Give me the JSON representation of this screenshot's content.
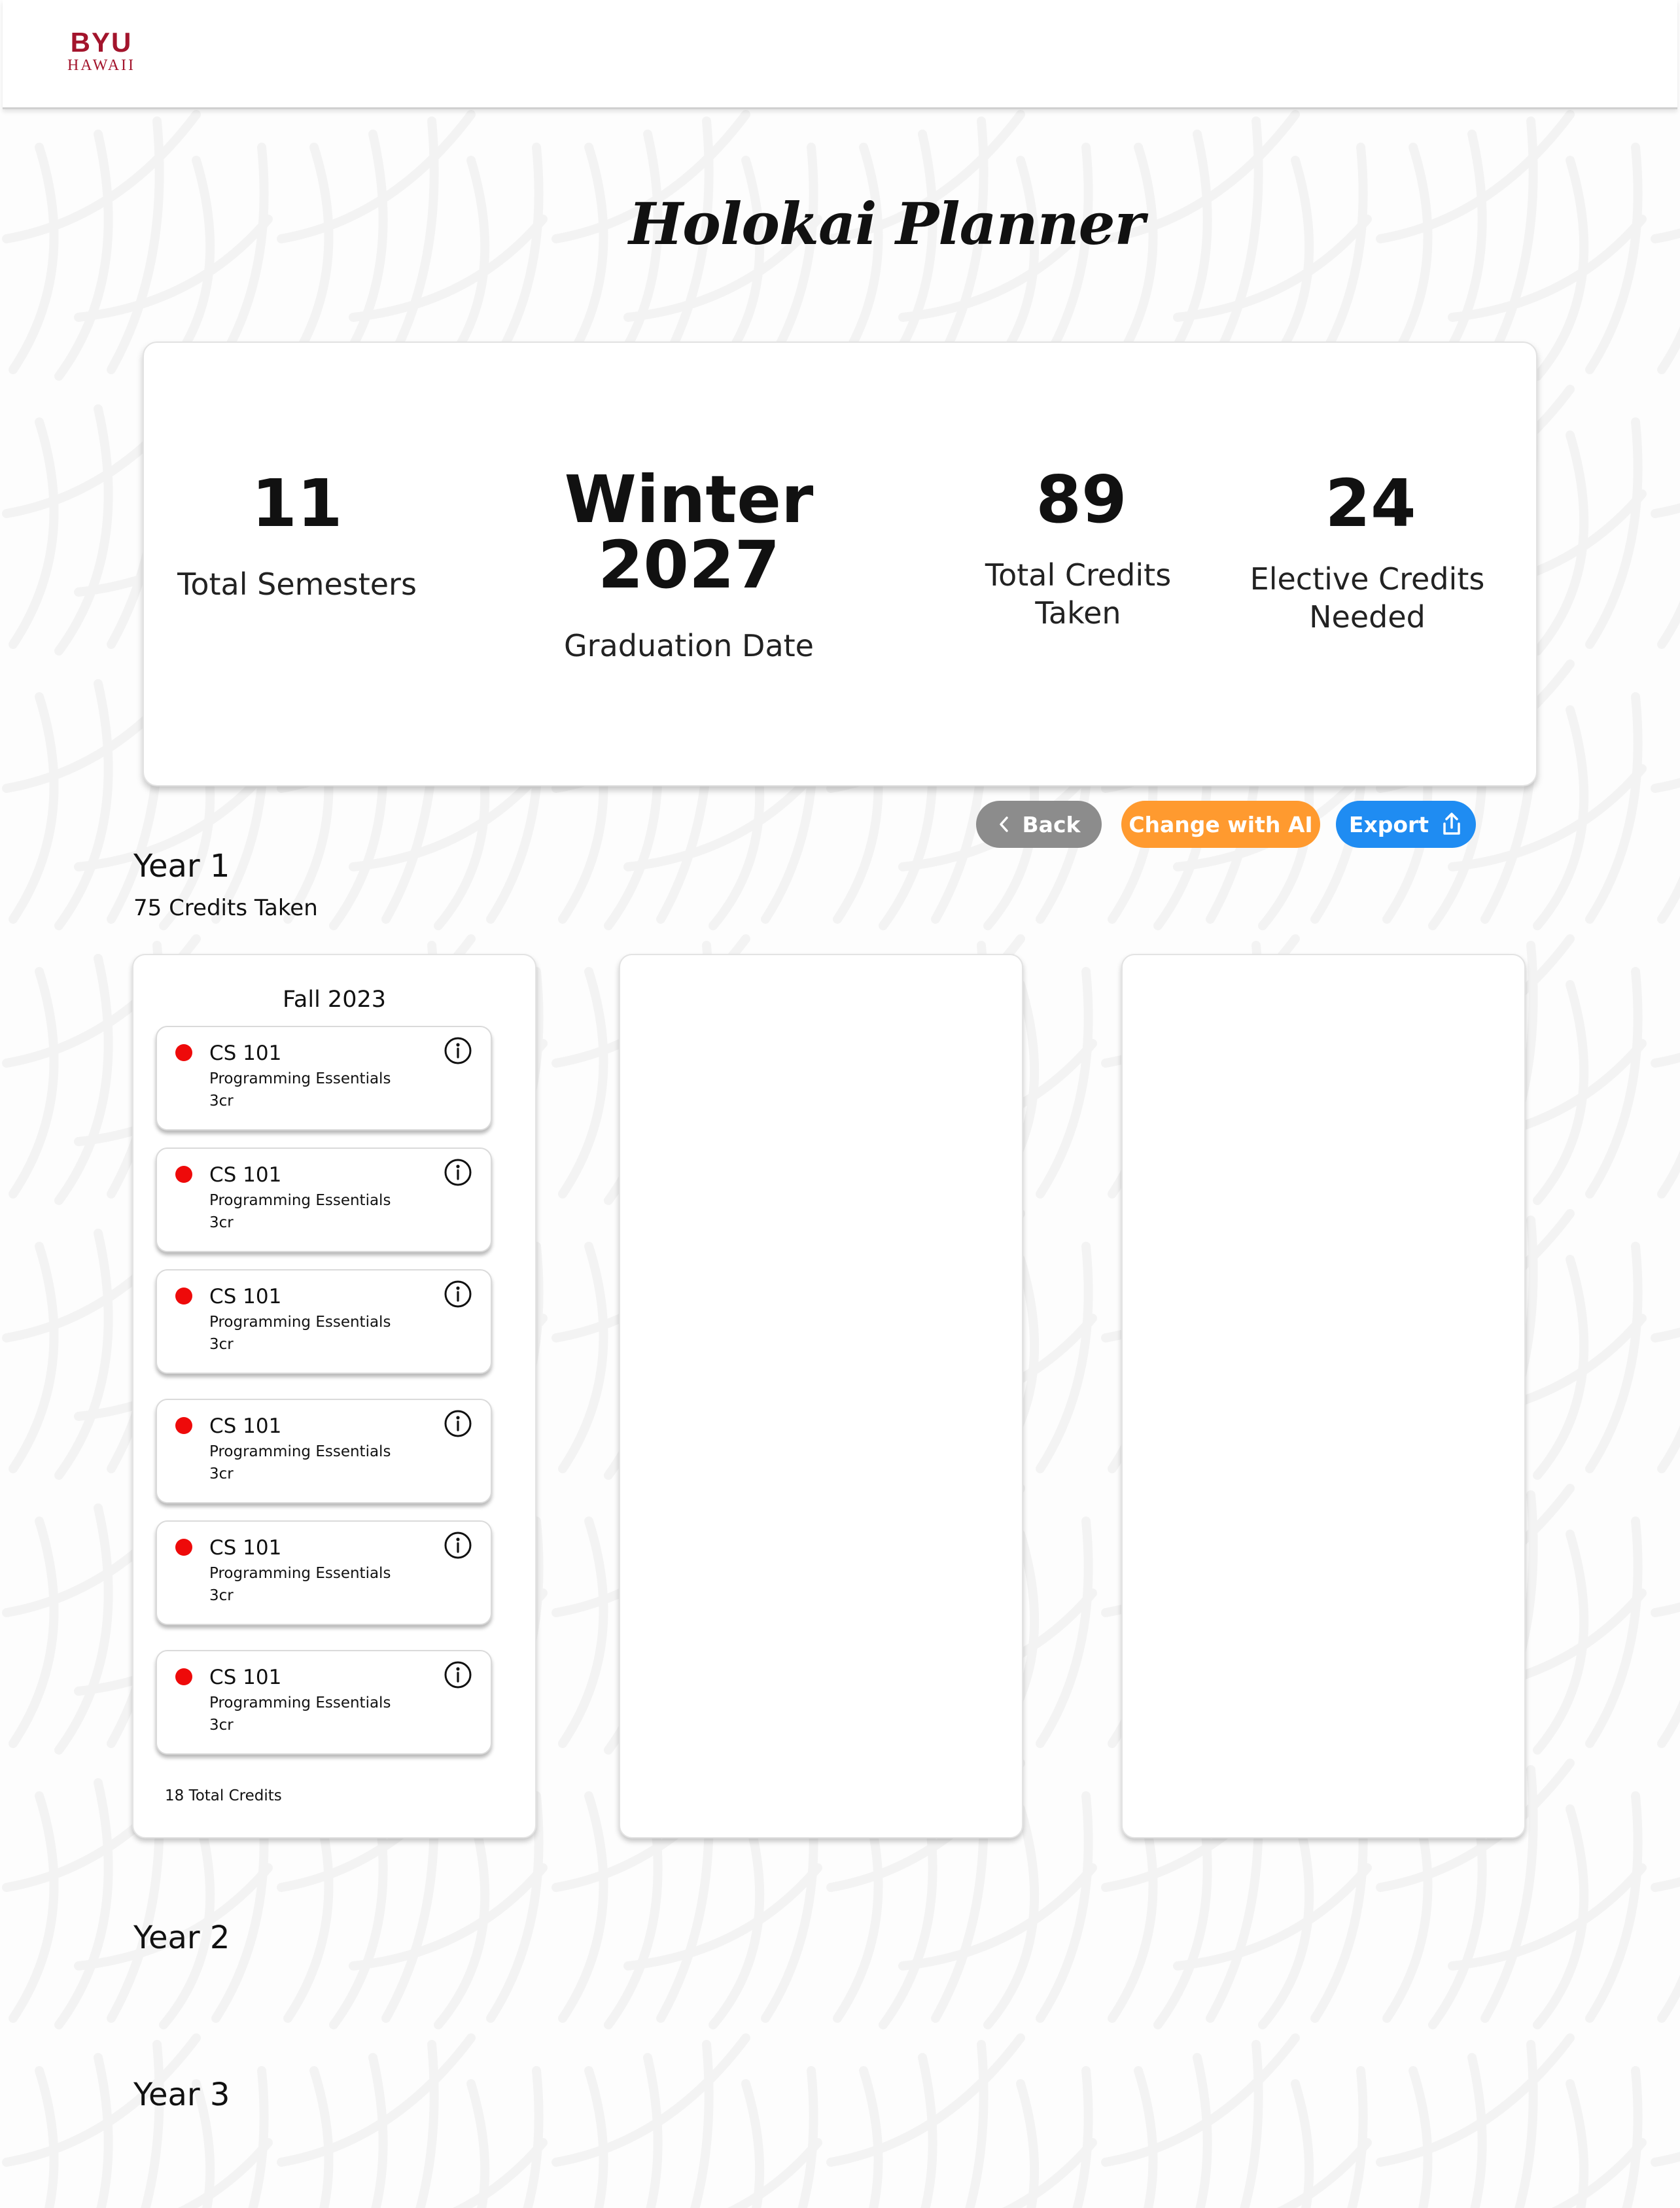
{
  "header": {
    "logo_main": "BYU",
    "logo_sub": "HAWAII"
  },
  "page_title": "Holokai Planner",
  "summary": {
    "total_semesters": {
      "value": "11",
      "label": "Total Semesters"
    },
    "graduation_date": {
      "value": "Winter 2027",
      "label": "Graduation Date"
    },
    "total_credits": {
      "value": "89",
      "label_line1": "Total Credits",
      "label_line2": "Taken"
    },
    "elective_credits": {
      "value": "24",
      "label_line1": "Elective Credits",
      "label_line2": "Needed"
    }
  },
  "actions": {
    "back_label": "Back",
    "ai_label": "Change with AI",
    "export_label": "Export"
  },
  "colors": {
    "brand": "#a3142c",
    "back_button": "#8c8c8c",
    "ai_button": "#ff9a2f",
    "export_button": "#1f8cf2",
    "course_status_dot": "#ee0a0a"
  },
  "years": [
    {
      "title": "Year 1",
      "credits_taken": "75 Credits Taken",
      "semesters": [
        {
          "title": "Fall 2023",
          "courses": [
            {
              "code": "CS 101",
              "name": "Programming Essentials",
              "credits": "3cr",
              "icon": "info-icon"
            },
            {
              "code": "CS 101",
              "name": "Programming Essentials",
              "credits": "3cr",
              "icon": "info-icon"
            },
            {
              "code": "CS 101",
              "name": "Programming Essentials",
              "credits": "3cr",
              "icon": "info-icon"
            },
            {
              "code": "CS 101",
              "name": "Programming Essentials",
              "credits": "3cr",
              "icon": "info-icon"
            },
            {
              "code": "CS 101",
              "name": "Programming Essentials",
              "credits": "3cr",
              "icon": "info-icon"
            },
            {
              "code": "CS 101",
              "name": "Programming Essentials",
              "credits": "3cr",
              "icon": "info-icon"
            }
          ],
          "total_credits": "18 Total Credits"
        },
        {
          "title": "",
          "courses": []
        },
        {
          "title": "",
          "courses": []
        }
      ]
    },
    {
      "title": "Year 2"
    },
    {
      "title": "Year 3"
    }
  ]
}
